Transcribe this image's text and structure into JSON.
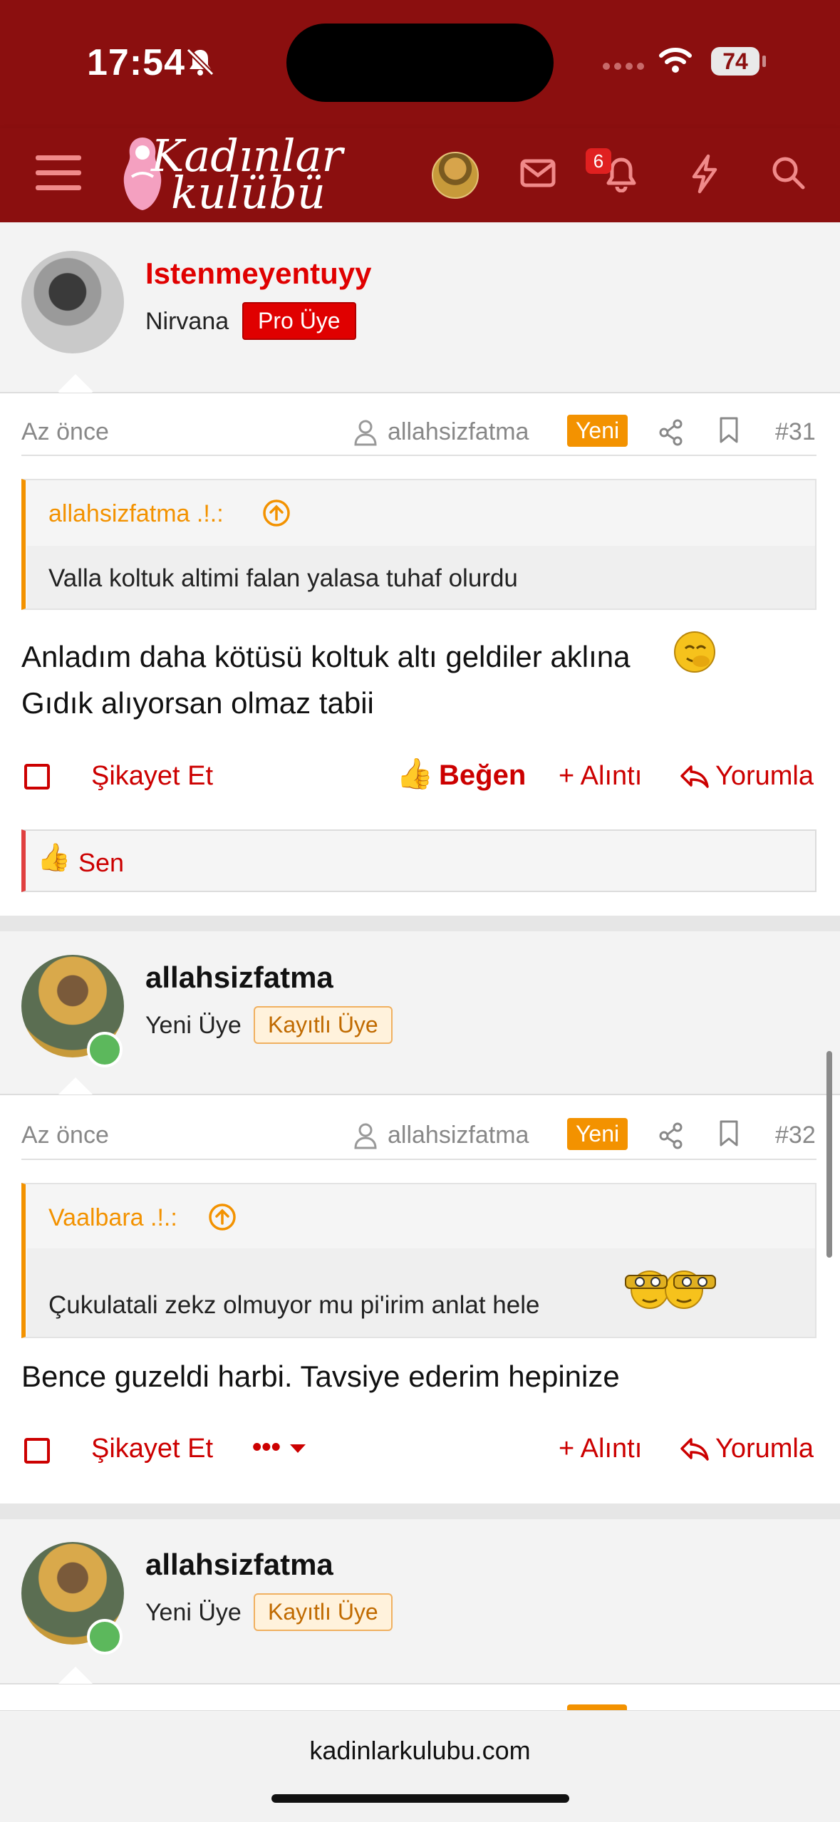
{
  "status": {
    "time": "17:54",
    "battery": "74"
  },
  "header": {
    "logo_line1": "Kadınlar",
    "logo_line2": "kulübü",
    "notification_count": "6",
    "icons": [
      "menu-icon",
      "avatar",
      "mail-icon",
      "bell-icon",
      "lightning-icon",
      "search-icon"
    ]
  },
  "posts": [
    {
      "author": "Istenmeyentuyy",
      "user_title": "Nirvana",
      "badge": "Pro Üye",
      "time": "Az önce",
      "viewer": "allahsizfatma",
      "new_label": "Yeni",
      "number": "#31",
      "quote_author": "allahsizfatma .!.:",
      "quote_text": "Valla koltuk altimi falan yalasa tuhaf olurdu",
      "body_line1": "Anladım daha kötüsü koltuk altı geldiler aklına",
      "body_line2": "Gıdık alıyorsan olmaz tabii",
      "report": "Şikayet Et",
      "like": "Beğen",
      "quote_action": "+ Alıntı",
      "reply": "Yorumla",
      "likes_summary": "Sen"
    },
    {
      "author": "allahsizfatma",
      "user_title": "Yeni Üye",
      "badge": "Kayıtlı Üye",
      "time": "Az önce",
      "viewer": "allahsizfatma",
      "new_label": "Yeni",
      "number": "#32",
      "quote_author": "Vaalbara .!.:",
      "quote_text": "Çukulatali zekz olmuyor mu pi'irim anlat hele",
      "body_line1": "Bence guzeldi harbi. Tavsiye ederim hepinize",
      "report": "Şikayet Et",
      "more": "•••",
      "quote_action": "+ Alıntı",
      "reply": "Yorumla"
    },
    {
      "author": "allahsizfatma",
      "user_title": "Yeni Üye",
      "badge": "Kayıtlı Üye"
    }
  ],
  "browser": {
    "url": "kadinlarkulubu.com"
  },
  "colors": {
    "brand": "#8b0f0f",
    "accent": "#f39200",
    "action": "#cc0000"
  }
}
